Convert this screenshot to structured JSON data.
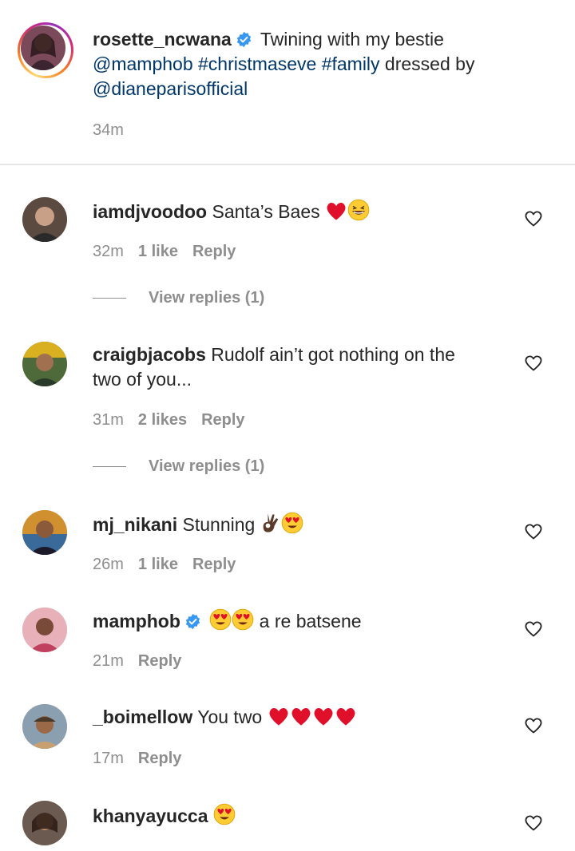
{
  "caption": {
    "username": "rosette_ncwana",
    "verified": true,
    "text_part1": " Twining with my bestie",
    "mention1": "@mamphob",
    "hashtag1": "#christmaseve",
    "hashtag2": "#family",
    "text_part2": " dressed by",
    "mention2": "@dianeparisofficial",
    "time": "34m"
  },
  "comments": [
    {
      "username": "iamdjvoodoo",
      "text": "Santa’s Baes",
      "emojis": [
        "heart-emoji",
        "grinning-squinting-emoji"
      ],
      "time": "32m",
      "likes": "1 like",
      "reply_label": "Reply",
      "view_replies": "View replies (1)"
    },
    {
      "username": "craigbjacobs",
      "text_line1": "Rudolf ain’t got nothing on the",
      "text_line2": "two of you...",
      "time": "31m",
      "likes": "2 likes",
      "reply_label": "Reply",
      "view_replies": "View replies (1)"
    },
    {
      "username": "mj_nikani",
      "text": "Stunning",
      "emojis": [
        "ok-hand-emoji",
        "heart-eyes-emoji"
      ],
      "time": "26m",
      "likes": "1 like",
      "reply_label": "Reply"
    },
    {
      "username": "mamphob",
      "verified": true,
      "emojis": [
        "heart-eyes-emoji",
        "heart-eyes-emoji"
      ],
      "text": "a re batsene",
      "time": "21m",
      "reply_label": "Reply"
    },
    {
      "username": "_boimellow",
      "text": "You two",
      "emojis": [
        "heart-emoji",
        "heart-emoji",
        "heart-emoji",
        "heart-emoji"
      ],
      "time": "17m",
      "reply_label": "Reply"
    },
    {
      "username": "khanyayucca",
      "emojis": [
        "heart-eyes-emoji"
      ]
    }
  ],
  "colors": {
    "link": "#00376b",
    "meta": "#8e8e8e",
    "verified": "#3897f0",
    "heart_emoji": "#e0102a"
  }
}
